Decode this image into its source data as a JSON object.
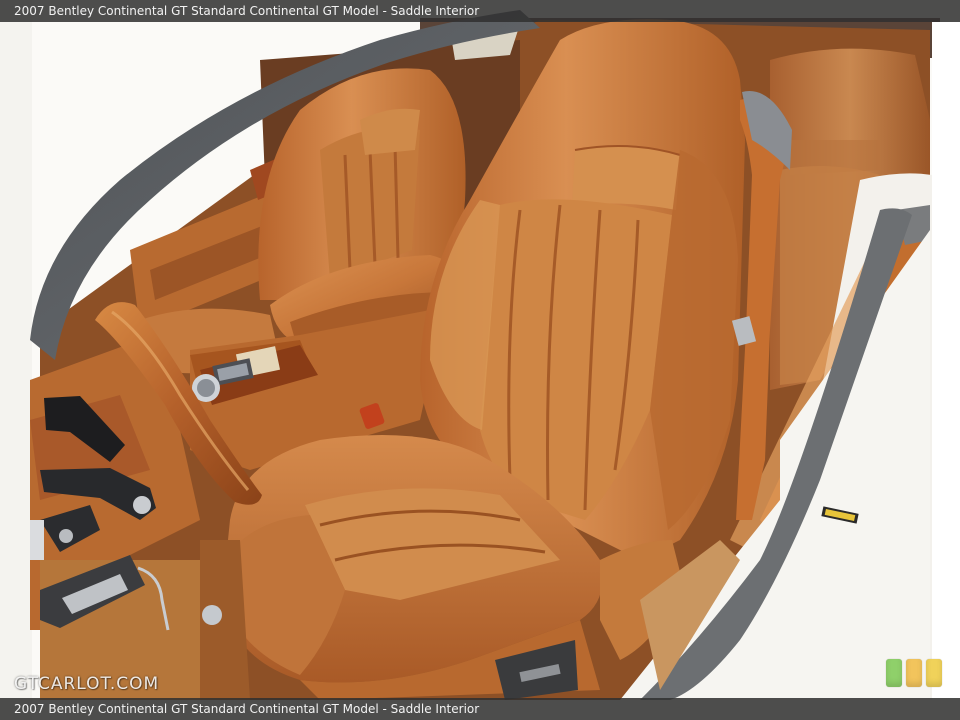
{
  "caption": {
    "top": "2007 Bentley Continental GT Standard Continental GT Model - Saddle Interior",
    "bottom": "2007 Bentley Continental GT Standard Continental GT Model - Saddle Interior"
  },
  "watermark": {
    "text": "GTCARLOT.COM"
  },
  "rating_badge": {
    "colors": [
      "#8fd06a",
      "#f2c45c",
      "#f0d25a"
    ]
  },
  "colors": {
    "leather": "#c8773a",
    "leather_dark": "#8f4a1f",
    "body_white": "#f3f1ec",
    "frame_gray": "#5f6367",
    "wood": "#b45f2a"
  }
}
